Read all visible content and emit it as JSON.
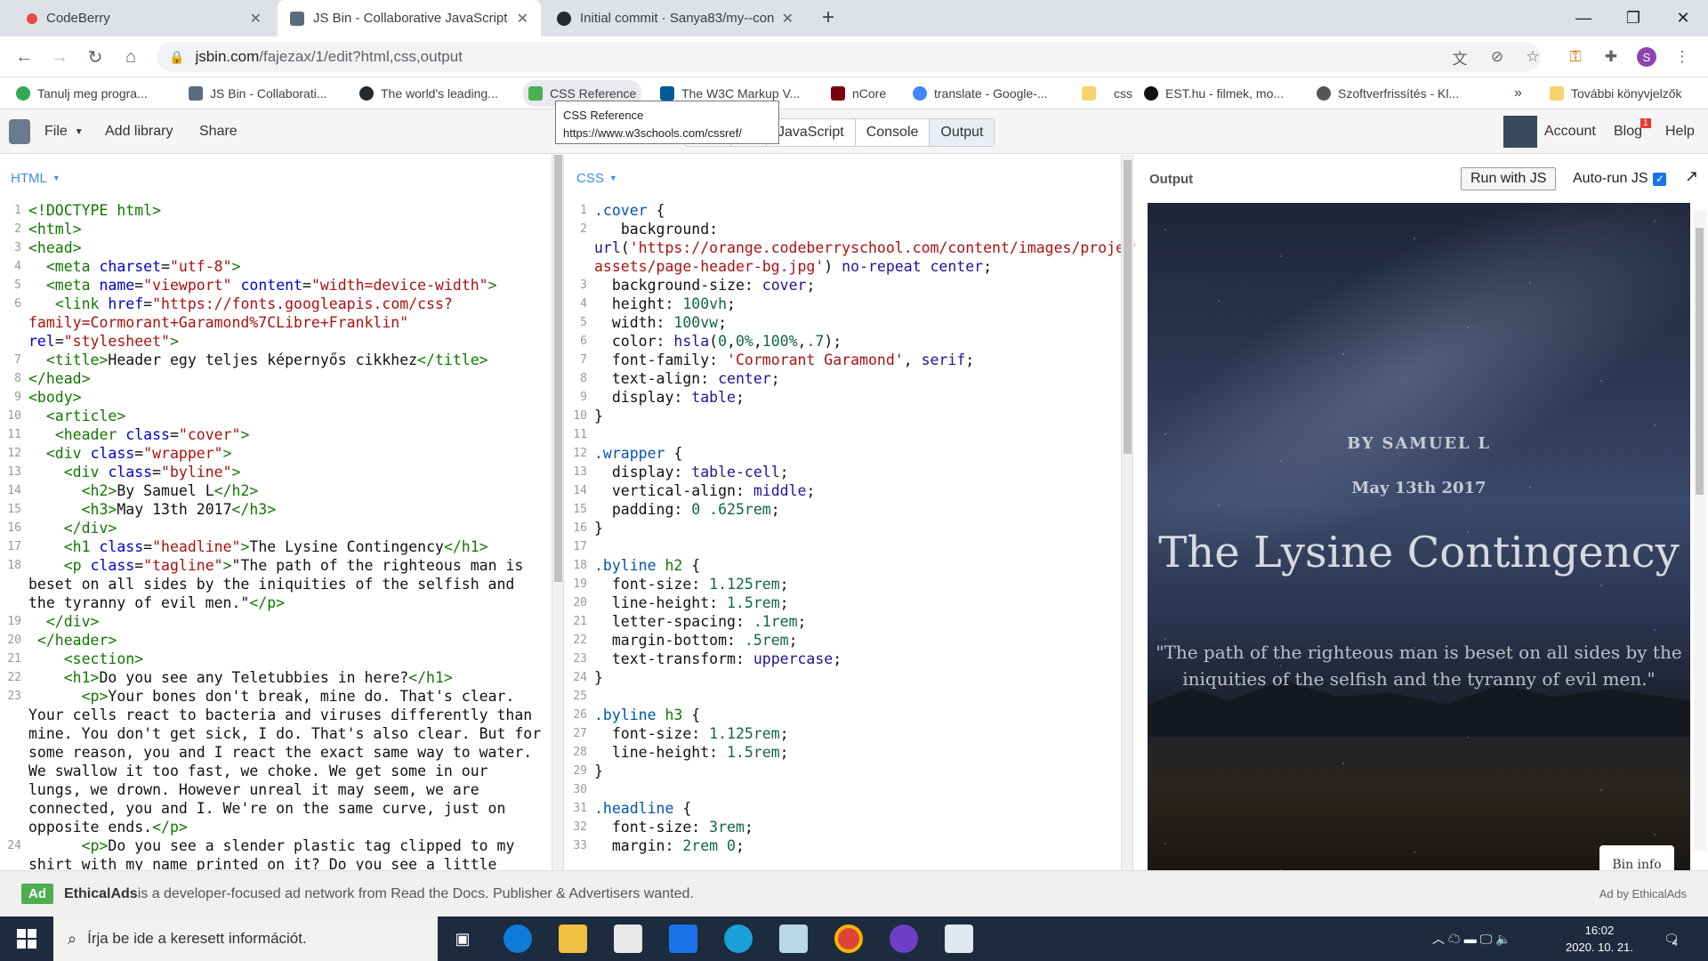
{
  "browser": {
    "tabs": [
      {
        "title": "CodeBerry",
        "active": false
      },
      {
        "title": "JS Bin - Collaborative JavaScript D",
        "active": true
      },
      {
        "title": "Initial commit · Sanya83/my--con",
        "active": false
      }
    ],
    "url_domain": "jsbin.com",
    "url_path": "/fajezax/1/edit?html,css,output",
    "profile_initial": "S",
    "bookmarks": [
      {
        "label": "Tanulj meg progra...",
        "color": "#34a853"
      },
      {
        "label": "JS Bin - Collaborati...",
        "color": "#5a6b7d"
      },
      {
        "label": "The world's leading...",
        "color": "#24292e"
      },
      {
        "label": "CSS Reference",
        "color": "#4caf50"
      },
      {
        "label": "The W3C Markup V...",
        "color": "#005a9c"
      },
      {
        "label": "nCore",
        "color": "#7a0010"
      },
      {
        "label": "translate - Google-...",
        "color": "#4285f4"
      },
      {
        "label": "css",
        "color": "#f5d46b"
      },
      {
        "label": "EST.hu - filmek, mo...",
        "color": "#111111"
      },
      {
        "label": "Szoftverfrissítés - Kl...",
        "color": "#555555"
      }
    ],
    "bookmarks_more": "»",
    "other_bookmarks": "További könyvjelzők",
    "tooltip_title": "CSS Reference",
    "tooltip_url": "https://www.w3schools.com/cssref/"
  },
  "jsbin": {
    "file": "File",
    "add_library": "Add library",
    "share": "Share",
    "panels": [
      "JavaScript",
      "Console",
      "Output"
    ],
    "account": "Account",
    "blog": "Blog",
    "blog_badge": "1",
    "help": "Help",
    "html_label": "HTML",
    "css_label": "CSS",
    "output_label": "Output",
    "run_with_js": "Run with JS",
    "auto_run": "Auto-run JS",
    "bin_info": "Bin info"
  },
  "html_code": [
    {
      "n": "1",
      "h": "<span class='tag'>&lt;!DOCTYPE html&gt;</span>"
    },
    {
      "n": "2",
      "h": "<span class='tag'>&lt;html&gt;</span>"
    },
    {
      "n": "3",
      "h": "<span class='tag'>&lt;head&gt;</span>"
    },
    {
      "n": "4",
      "h": "  <span class='tag'>&lt;meta</span> <span class='at'>charset</span>=<span class='st'>\"utf-8\"</span><span class='tag'>&gt;</span>"
    },
    {
      "n": "5",
      "h": "  <span class='tag'>&lt;meta</span> <span class='at'>name</span>=<span class='st'>\"viewport\"</span> <span class='at'>content</span>=<span class='st'>\"width=device-width\"</span><span class='tag'>&gt;</span>"
    },
    {
      "n": "6",
      "h": "   <span class='tag'>&lt;link</span> <span class='at'>href</span>=<span class='st'>\"https://fonts.googleapis.com/css?family=Cormorant+Garamond%7CLibre+Franklin\"</span> <span class='at'>rel</span>=<span class='st'>\"stylesheet\"</span><span class='tag'>&gt;</span>"
    },
    {
      "n": "7",
      "h": "  <span class='tag'>&lt;title&gt;</span>Header egy teljes képernyős cikkhez<span class='tag'>&lt;/title&gt;</span>"
    },
    {
      "n": "8",
      "h": "<span class='tag'>&lt;/head&gt;</span>"
    },
    {
      "n": "9",
      "h": "<span class='tag'>&lt;body&gt;</span>"
    },
    {
      "n": "10",
      "h": "  <span class='tag'>&lt;article&gt;</span>"
    },
    {
      "n": "11",
      "h": "   <span class='tag'>&lt;header</span> <span class='at'>class</span>=<span class='st'>\"cover\"</span><span class='tag'>&gt;</span>"
    },
    {
      "n": "12",
      "h": "  <span class='tag'>&lt;div</span> <span class='at'>class</span>=<span class='st'>\"wrapper\"</span><span class='tag'>&gt;</span>"
    },
    {
      "n": "13",
      "h": "    <span class='tag'>&lt;div</span> <span class='at'>class</span>=<span class='st'>\"byline\"</span><span class='tag'>&gt;</span>"
    },
    {
      "n": "14",
      "h": "      <span class='tag'>&lt;h2&gt;</span>By Samuel L<span class='tag'>&lt;/h2&gt;</span>"
    },
    {
      "n": "15",
      "h": "      <span class='tag'>&lt;h3&gt;</span>May 13th 2017<span class='tag'>&lt;/h3&gt;</span>"
    },
    {
      "n": "16",
      "h": "    <span class='tag'>&lt;/div&gt;</span>"
    },
    {
      "n": "17",
      "h": "    <span class='tag'>&lt;h1</span> <span class='at'>class</span>=<span class='st'>\"headline\"</span><span class='tag'>&gt;</span>The Lysine Contingency<span class='tag'>&lt;/h1&gt;</span>"
    },
    {
      "n": "18",
      "h": "    <span class='tag'>&lt;p</span> <span class='at'>class</span>=<span class='st'>\"tagline\"</span><span class='tag'>&gt;</span>\"The path of the righteous man is beset on all sides by the iniquities of the selfish and the tyranny of evil men.\"<span class='tag'>&lt;/p&gt;</span>"
    },
    {
      "n": "19",
      "h": "  <span class='tag'>&lt;/div&gt;</span>"
    },
    {
      "n": "20",
      "h": " <span class='tag'>&lt;/header&gt;</span>"
    },
    {
      "n": "21",
      "h": "    <span class='tag'>&lt;section&gt;</span>"
    },
    {
      "n": "22",
      "h": "    <span class='tag'>&lt;h1&gt;</span>Do you see any Teletubbies in here?<span class='tag'>&lt;/h1&gt;</span>"
    },
    {
      "n": "23",
      "h": "      <span class='tag'>&lt;p&gt;</span>Your bones don't break, mine do. That's clear. Your cells react to bacteria and viruses differently than mine. You don't get sick, I do. That's also clear. But for some reason, you and I react the exact same way to water. We swallow it too fast, we choke. We get some in our lungs, we drown. However unreal it may seem, we are connected, you and I. We're on the same curve, just on opposite ends.<span class='tag'>&lt;/p&gt;</span>"
    },
    {
      "n": "24",
      "h": "      <span class='tag'>&lt;p&gt;</span>Do you see a slender plastic tag clipped to my shirt with my name printed on it? Do you see a little"
    }
  ],
  "css_code": [
    {
      "n": "1",
      "h": "<span class='sel'>.cover</span> {"
    },
    {
      "n": "2",
      "h": "   <span class='pr'>background</span>: <span class='vl'>url</span>(<span class='st'>'https://orange.codeberryschool.com/content/images/project-assets/page-header-bg.jpg'</span>) <span class='vl'>no-repeat center</span>;"
    },
    {
      "n": "3",
      "h": "  <span class='pr'>background-size</span>: <span class='vl'>cover</span>;"
    },
    {
      "n": "4",
      "h": "  <span class='pr'>height</span>: <span class='num'>100vh</span>;"
    },
    {
      "n": "5",
      "h": "  <span class='pr'>width</span>: <span class='num'>100vw</span>;"
    },
    {
      "n": "6",
      "h": "  <span class='pr'>color</span>: <span class='vl'>hsla</span>(<span class='num'>0</span>,<span class='num'>0%</span>,<span class='num'>100%</span>,<span class='num'>.7</span>);"
    },
    {
      "n": "7",
      "h": "  <span class='pr'>font-family</span>: <span class='st'>'Cormorant Garamond'</span>, <span class='vl'>serif</span>;"
    },
    {
      "n": "8",
      "h": "  <span class='pr'>text-align</span>: <span class='vl'>center</span>;"
    },
    {
      "n": "9",
      "h": "  <span class='pr'>display</span>: <span class='vl'>table</span>;"
    },
    {
      "n": "10",
      "h": "}"
    },
    {
      "n": "11",
      "h": ""
    },
    {
      "n": "12",
      "h": "<span class='sel'>.wrapper</span> {"
    },
    {
      "n": "13",
      "h": "  <span class='pr'>display</span>: <span class='vl'>table-cell</span>;"
    },
    {
      "n": "14",
      "h": "  <span class='pr'>vertical-align</span>: <span class='vl'>middle</span>;"
    },
    {
      "n": "15",
      "h": "  <span class='pr'>padding</span>: <span class='num'>0</span> <span class='num'>.625rem</span>;"
    },
    {
      "n": "16",
      "h": "}"
    },
    {
      "n": "17",
      "h": ""
    },
    {
      "n": "18",
      "h": "<span class='sel'>.byline</span> <span class='tag'>h2</span> {"
    },
    {
      "n": "19",
      "h": "  <span class='pr'>font-size</span>: <span class='num'>1.125rem</span>;"
    },
    {
      "n": "20",
      "h": "  <span class='pr'>line-height</span>: <span class='num'>1.5rem</span>;"
    },
    {
      "n": "21",
      "h": "  <span class='pr'>letter-spacing</span>: <span class='num'>.1rem</span>;"
    },
    {
      "n": "22",
      "h": "  <span class='pr'>margin-bottom</span>: <span class='num'>.5rem</span>;"
    },
    {
      "n": "23",
      "h": "  <span class='pr'>text-transform</span>: <span class='vl'>uppercase</span>;"
    },
    {
      "n": "24",
      "h": "}"
    },
    {
      "n": "25",
      "h": ""
    },
    {
      "n": "26",
      "h": "<span class='sel'>.byline</span> <span class='tag'>h3</span> {"
    },
    {
      "n": "27",
      "h": "  <span class='pr'>font-size</span>: <span class='num'>1.125rem</span>;"
    },
    {
      "n": "28",
      "h": "  <span class='pr'>line-height</span>: <span class='num'>1.5rem</span>;"
    },
    {
      "n": "29",
      "h": "}"
    },
    {
      "n": "30",
      "h": ""
    },
    {
      "n": "31",
      "h": "<span class='sel'>.headline</span> {"
    },
    {
      "n": "32",
      "h": "  <span class='pr'>font-size</span>: <span class='num'>3rem</span>;"
    },
    {
      "n": "33",
      "h": "  <span class='pr'>margin</span>: <span class='num'>2rem</span> <span class='num'>0</span>;"
    }
  ],
  "output": {
    "byline": "By Samuel L",
    "date": "May 13th 2017",
    "headline": "The Lysine Contingency",
    "tagline": "\"The path of the righteous man is beset on all sides by the iniquities of the selfish and the tyranny of evil men.\""
  },
  "ad": {
    "badge": "Ad",
    "brand": "EthicalAds",
    "text": " is a developer-focused ad network from Read the Docs. Publisher & Advertisers wanted.",
    "credit": "Ad by EthicalAds"
  },
  "taskbar": {
    "search_placeholder": "Írja be ide a keresett információt.",
    "time": "16:02",
    "date": "2020. 10. 21.",
    "notifications": "4"
  }
}
